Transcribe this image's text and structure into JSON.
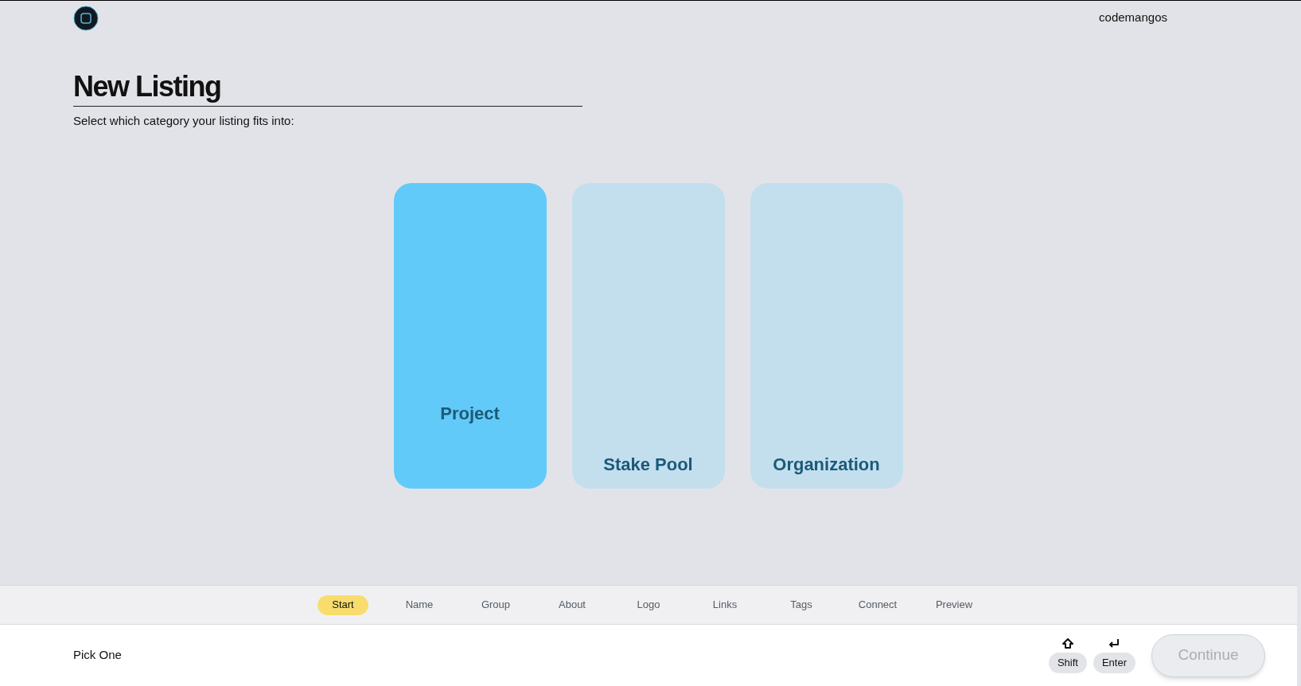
{
  "header": {
    "username": "codemangos"
  },
  "page": {
    "title": "New Listing",
    "subtitle": "Select which category your listing fits into:"
  },
  "categories": [
    {
      "label": "Project",
      "selected": true
    },
    {
      "label": "Stake Pool",
      "selected": false
    },
    {
      "label": "Organization",
      "selected": false
    }
  ],
  "steps": [
    {
      "label": "Start",
      "selected": true
    },
    {
      "label": "Name",
      "selected": false
    },
    {
      "label": "Group",
      "selected": false
    },
    {
      "label": "About",
      "selected": false
    },
    {
      "label": "Logo",
      "selected": false
    },
    {
      "label": "Links",
      "selected": false
    },
    {
      "label": "Tags",
      "selected": false
    },
    {
      "label": "Connect",
      "selected": false
    },
    {
      "label": "Preview",
      "selected": false
    }
  ],
  "footer": {
    "hint": "Pick One",
    "keys": [
      {
        "kind": "shift",
        "label": "Shift"
      },
      {
        "kind": "enter",
        "label": "Enter"
      }
    ],
    "continue": {
      "label": "Continue",
      "disabled": true
    }
  }
}
